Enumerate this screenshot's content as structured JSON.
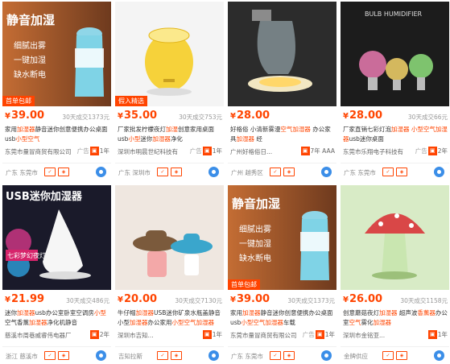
{
  "products": [
    {
      "image_overlay": [
        "静音加湿",
        "细腻出雾",
        "一键加湿",
        "缺水断电"
      ],
      "tag": "首单包邮",
      "price": "39.00",
      "currency": "¥",
      "sold": "30天成交1373元",
      "title_parts": [
        {
          "t": "家用",
          "hl": false
        },
        {
          "t": "加湿器",
          "hl": true
        },
        {
          "t": "静音迷你创意便携办公桌面usb",
          "hl": false
        },
        {
          "t": "小型空气",
          "hl": true
        }
      ],
      "ad": "广告",
      "shop": "东莞市量冒商贸有限公司",
      "years": "1年",
      "location": "广东 东莞市"
    },
    {
      "tag": "假入精选",
      "price": "35.00",
      "currency": "¥",
      "sold": "30天成交753元",
      "title_parts": [
        {
          "t": "厂家批发柠檬夜灯",
          "hl": false
        },
        {
          "t": "加湿",
          "hl": true
        },
        {
          "t": "创意家用桌面usb",
          "hl": false
        },
        {
          "t": "小型",
          "hl": true
        },
        {
          "t": "迷你",
          "hl": false
        },
        {
          "t": "加湿器",
          "hl": true
        },
        {
          "t": "净化",
          "hl": false
        }
      ],
      "ad": "广告",
      "shop": "深圳市明晨世纪科技有",
      "years": "1年",
      "location": "广东 深圳市"
    },
    {
      "price": "28.00",
      "currency": "¥",
      "sold": "",
      "title_parts": [
        {
          "t": "好格俗 小清新雾漫",
          "hl": false
        },
        {
          "t": "空气加湿器",
          "hl": true
        },
        {
          "t": " 办公家具",
          "hl": false
        },
        {
          "t": "加湿器",
          "hl": true
        },
        {
          "t": " 经",
          "hl": false
        }
      ],
      "ad": "",
      "shop": "广州好格俗日...",
      "years": "7年 AAA",
      "location": "广州 越秀区"
    },
    {
      "image_overlay": [
        "BULB HUMIDIFIER"
      ],
      "price": "28.00",
      "currency": "¥",
      "sold": "30天成交66元",
      "title_parts": [
        {
          "t": "厂家直销七彩灯泡",
          "hl": false
        },
        {
          "t": "加湿器",
          "hl": true
        },
        {
          "t": " ",
          "hl": false
        },
        {
          "t": "小型空气",
          "hl": true
        },
        {
          "t": "加湿器",
          "hl": true
        },
        {
          "t": "usb迷你桌面",
          "hl": false
        }
      ],
      "ad": "广告",
      "shop": "东莞市乐翔电子科技有",
      "years": "2年",
      "location": "广东 东莞市"
    },
    {
      "image_overlay": [
        "USB迷你加湿器",
        "七彩梦幻夜灯"
      ],
      "price": "21.99",
      "currency": "¥",
      "sold": "30天成交486元",
      "title_parts": [
        {
          "t": "迷你",
          "hl": false
        },
        {
          "t": "加湿器",
          "hl": true
        },
        {
          "t": "usb办公室卧室空调房",
          "hl": false
        },
        {
          "t": "小型",
          "hl": true
        },
        {
          "t": "空气香薰",
          "hl": false
        },
        {
          "t": "加湿器",
          "hl": true
        },
        {
          "t": "净化机静音",
          "hl": false
        }
      ],
      "ad": "",
      "shop": "慈溪市周巷威睿伟电器厂",
      "years": "2年",
      "location": "浙江 慈溪市"
    },
    {
      "price": "20.00",
      "currency": "¥",
      "sold": "30天成交7130元",
      "title_parts": [
        {
          "t": "牛仔帽",
          "hl": false
        },
        {
          "t": "加湿器",
          "hl": true
        },
        {
          "t": "USB迷你矿泉水瓶盖静音小型",
          "hl": false
        },
        {
          "t": "加湿器",
          "hl": true
        },
        {
          "t": "办公家用",
          "hl": false
        },
        {
          "t": "小型空气加湿器",
          "hl": true
        }
      ],
      "ad": "",
      "shop": "深圳市吉知...",
      "years": "1年",
      "location": "吉知拉斯"
    },
    {
      "image_overlay": [
        "静音加湿",
        "细腻出雾",
        "一键加湿",
        "缺水断电"
      ],
      "tag": "首单包邮",
      "price": "39.00",
      "currency": "¥",
      "sold": "30天成交1373元",
      "title_parts": [
        {
          "t": "家用",
          "hl": false
        },
        {
          "t": "加湿器",
          "hl": true
        },
        {
          "t": "静音迷你创意便携办公桌面usb",
          "hl": false
        },
        {
          "t": "小型空气加湿器",
          "hl": true
        },
        {
          "t": "车载",
          "hl": false
        }
      ],
      "ad": "广告",
      "shop": "东莞市量冒商贸有限公司",
      "years": "1年",
      "location": "广东 东莞市"
    },
    {
      "price": "26.00",
      "currency": "¥",
      "sold": "30天成交1158元",
      "title_parts": [
        {
          "t": "创意蘑菇夜灯",
          "hl": false
        },
        {
          "t": "加湿器",
          "hl": true
        },
        {
          "t": " 超声波",
          "hl": false
        },
        {
          "t": "香薰器",
          "hl": true
        },
        {
          "t": "办公室",
          "hl": false
        },
        {
          "t": "空气",
          "hl": true
        },
        {
          "t": "雾化",
          "hl": false
        },
        {
          "t": "加湿器",
          "hl": true
        }
      ],
      "ad": "",
      "shop": "深圳市金铭亚...",
      "years": "1年",
      "location": "金牌供应"
    }
  ],
  "colors": {
    "accent": "#ff4400",
    "sold_gray": "#999999",
    "ww_blue": "#3b8ee8"
  }
}
